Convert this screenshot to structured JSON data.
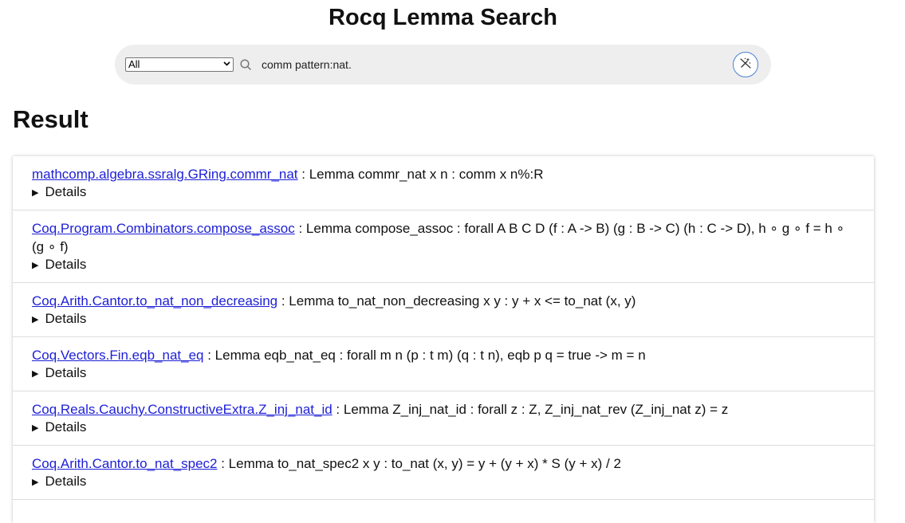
{
  "page": {
    "title": "Rocq Lemma Search"
  },
  "search": {
    "scope_selected": "All",
    "query": "comm pattern:nat."
  },
  "results": {
    "heading": "Result",
    "details_label": "Details",
    "items": [
      {
        "name": "mathcomp.algebra.ssralg.GRing.commr_nat",
        "statement": " : Lemma commr_nat x n : comm x n%:R"
      },
      {
        "name": "Coq.Program.Combinators.compose_assoc",
        "statement": " : Lemma compose_assoc : forall A B C D (f : A -> B) (g : B -> C) (h : C -> D), h ∘ g ∘ f = h ∘ (g ∘ f)"
      },
      {
        "name": "Coq.Arith.Cantor.to_nat_non_decreasing",
        "statement": " : Lemma to_nat_non_decreasing x y : y + x <= to_nat (x, y)"
      },
      {
        "name": "Coq.Vectors.Fin.eqb_nat_eq",
        "statement": " : Lemma eqb_nat_eq : forall m n (p : t m) (q : t n), eqb p q = true -> m = n"
      },
      {
        "name": "Coq.Reals.Cauchy.ConstructiveExtra.Z_inj_nat_id",
        "statement": " : Lemma Z_inj_nat_id : forall z : Z, Z_inj_nat_rev (Z_inj_nat z) = z"
      },
      {
        "name": "Coq.Arith.Cantor.to_nat_spec2",
        "statement": " : Lemma to_nat_spec2 x y : to_nat (x, y) = y + (y + x) * S (y + x) / 2"
      }
    ]
  },
  "colors": {
    "link": "#1d1fd6",
    "search_bar_bg": "#eeeeee",
    "ai_button_border": "#4a7fd6"
  },
  "icons": {
    "search": "search-icon",
    "ai": "magic-wand-icon",
    "details": "triangle-right-icon",
    "select": "chevron-down-icon"
  }
}
